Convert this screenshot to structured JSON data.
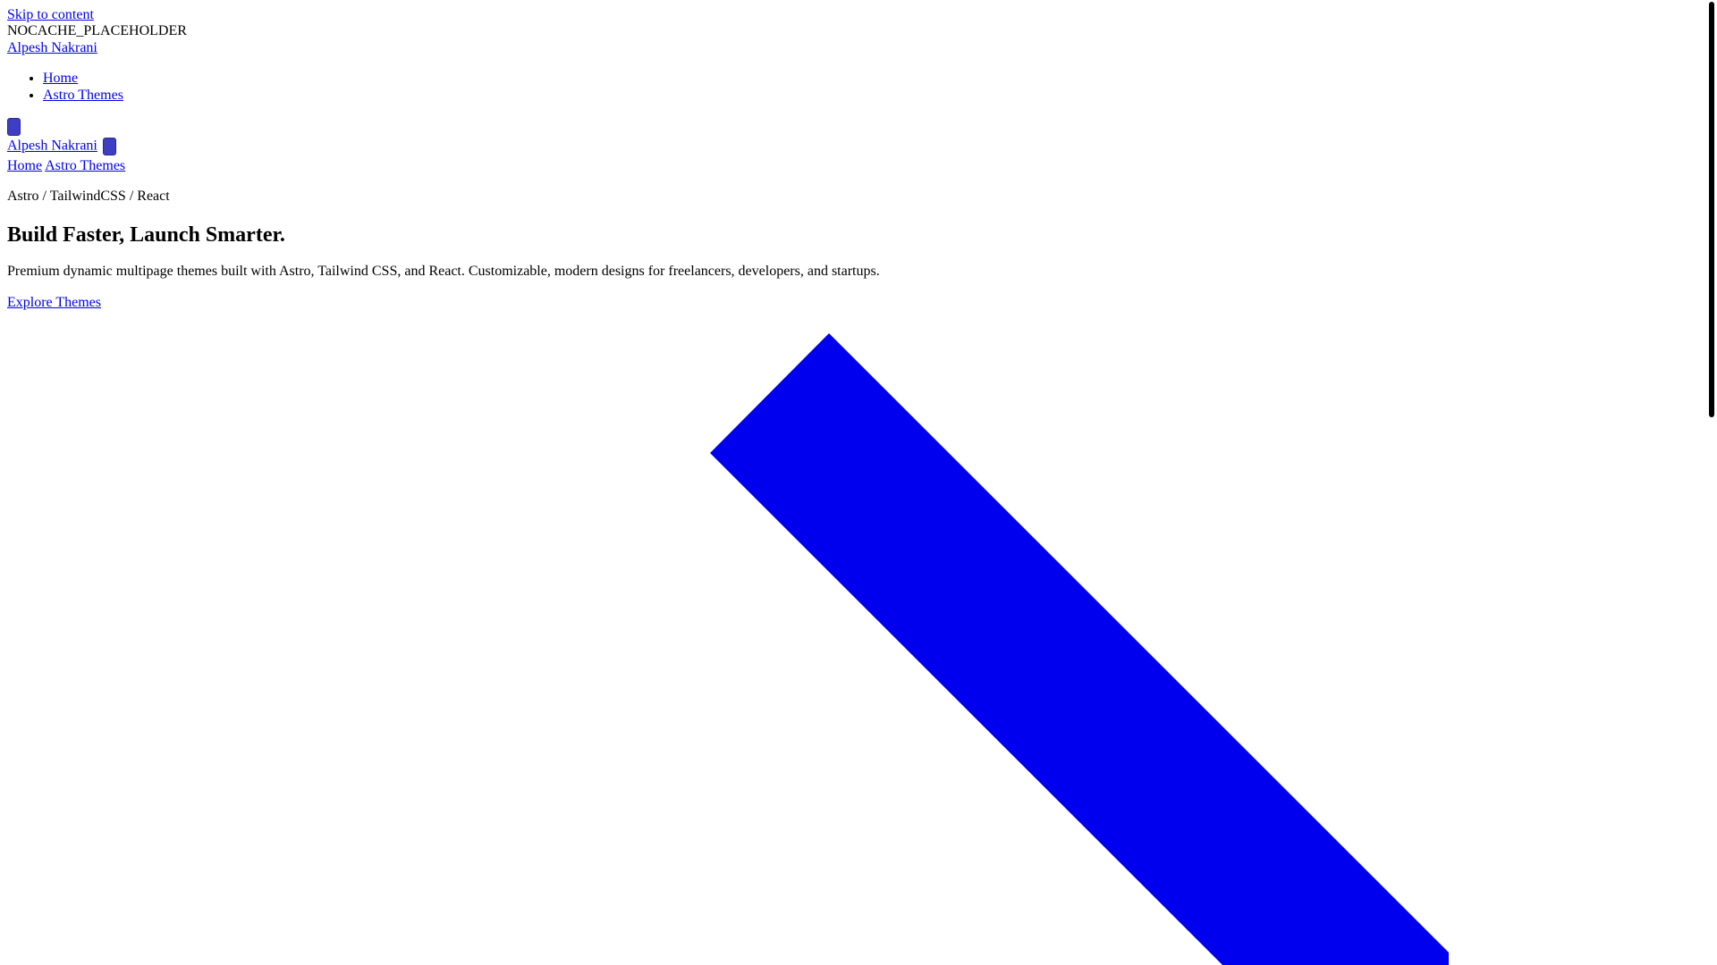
{
  "skip_link": "Skip to content",
  "placeholder": "NOCACHE_PLACEHOLDER",
  "header": {
    "brand": "Alpesh Nakrani",
    "nav": [
      {
        "label": "Home"
      },
      {
        "label": "Astro Themes"
      }
    ]
  },
  "mobile_header": {
    "brand": "Alpesh Nakrani",
    "links": [
      {
        "label": "Home"
      },
      {
        "label": "Astro Themes"
      }
    ]
  },
  "hero": {
    "stack": "Astro / TailwindCSS / React",
    "title": "Build Faster, Launch Smarter.",
    "description": "Premium dynamic multipage themes built with Astro, Tailwind CSS, and React. Customizable, modern designs for freelancers, developers, and startups.",
    "cta": "Explore Themes"
  },
  "icons": {
    "menu_toggle": "menu-icon",
    "close_toggle": "close-icon",
    "decorative_shape": "chevron-icon"
  },
  "colors": {
    "link": "#0000ee",
    "button": "#3d3ec4",
    "shape": "#0000ee"
  }
}
